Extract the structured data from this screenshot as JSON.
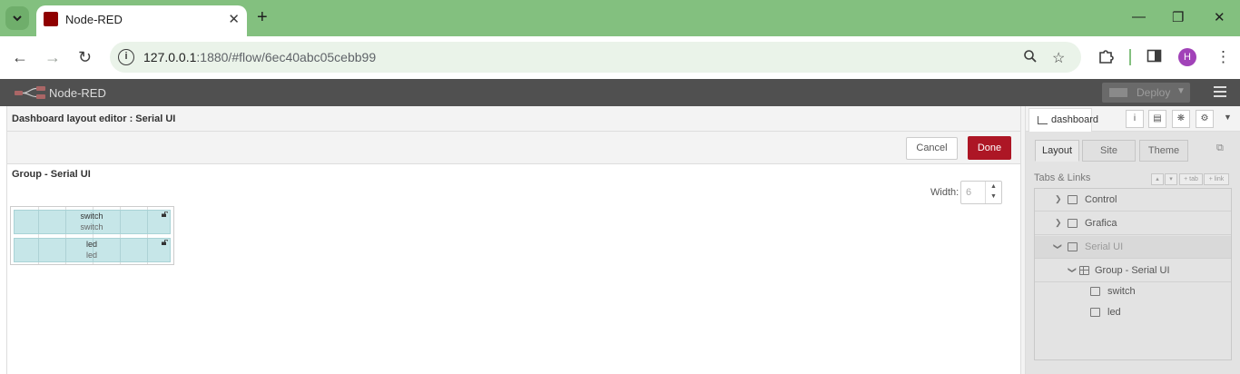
{
  "browser": {
    "tab_title": "Node-RED",
    "tab_close": "✕",
    "new_tab": "+",
    "url_host": "127.0.0.1",
    "url_path": ":1880/#flow/6ec40abc05cebb99",
    "profile_initial": "H",
    "window_controls": [
      "—",
      "❐",
      "✕"
    ]
  },
  "header": {
    "app_title": "Node-RED",
    "deploy_label": "Deploy"
  },
  "editor": {
    "title": "Dashboard layout editor : Serial UI",
    "cancel_label": "Cancel",
    "done_label": "Done",
    "group_title": "Group - Serial UI",
    "width_label": "Width:",
    "width_value": "6",
    "widgets": [
      {
        "name": "switch",
        "type": "switch"
      },
      {
        "name": "led",
        "type": "led"
      }
    ]
  },
  "sidebar": {
    "tab_label": "dashboard",
    "dash_tabs": [
      "Layout",
      "Site",
      "Theme"
    ],
    "tabs_links_label": "Tabs & Links",
    "mini_buttons": [
      "▴",
      "▾",
      "+ tab",
      "+ link"
    ],
    "tree": {
      "tabs": [
        "Control",
        "Grafica",
        "Serial UI"
      ],
      "group": "Group - Serial UI",
      "widgets": [
        "switch",
        "led"
      ]
    }
  },
  "colors": {
    "browser_frame": "#83c07f",
    "nr_header": "#505050",
    "done_button": "#ad1625",
    "widget_fill": "#c6e6e8"
  }
}
